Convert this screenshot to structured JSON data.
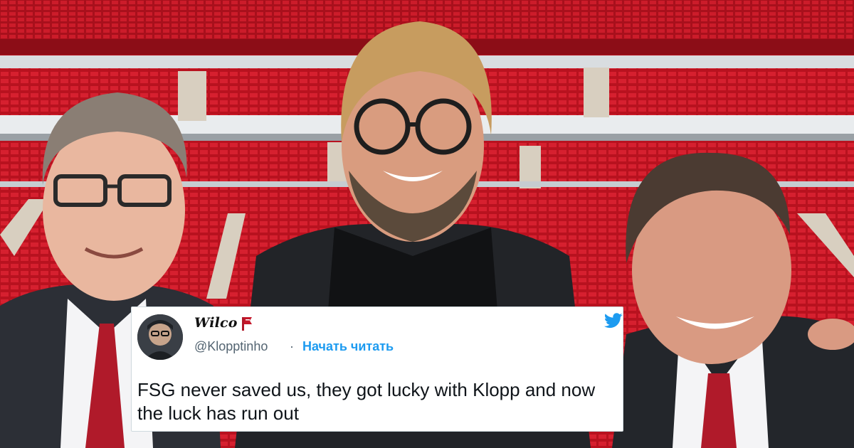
{
  "tweet": {
    "display_name": "Wilco",
    "handle": "@Klopptinho",
    "separator": "·",
    "follow_label": "Начать читать",
    "text": "FSG never saved us, they got lucky with Klopp and now the luck has run out",
    "flag_icon": "red-flag-icon",
    "brand_icon": "twitter-bird-icon",
    "brand_color": "#1d9bf0"
  },
  "background": {
    "description_icon": "stadium-photo"
  }
}
